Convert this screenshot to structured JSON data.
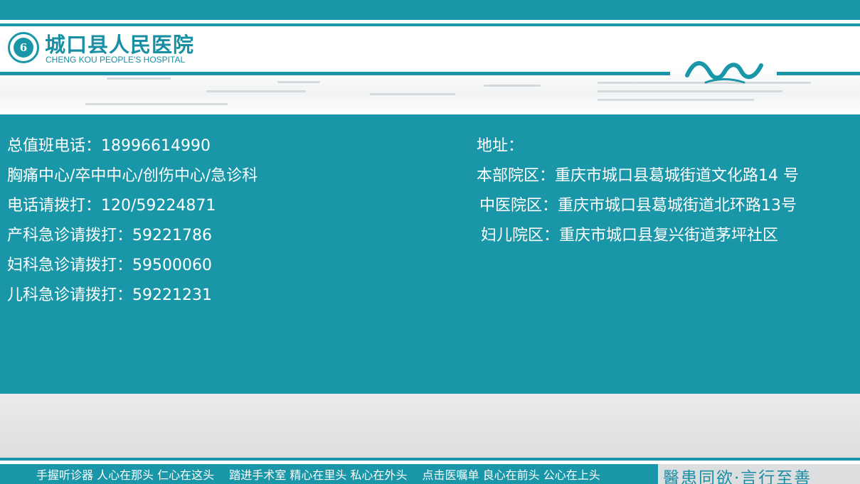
{
  "header": {
    "hospital_name_cn": "城口县人民医院",
    "hospital_name_en": "CHENG KOU PEOPLE'S HOSPITAL",
    "logo_glyph": "6"
  },
  "contacts": [
    "总值班电话：18996614990",
    "胸痛中心/卒中中心/创伤中心/急诊科",
    "电话请拨打：120/59224871",
    "产科急诊请拨打：59221786",
    "妇科急诊请拨打：59500060",
    "儿科急诊请拨打：59221231"
  ],
  "address": {
    "heading": "地址：",
    "lines": [
      "本部院区：重庆市城口县葛城街道文化路14 号",
      "中医院区：重庆市城口县葛城街道北环路13号",
      "妇儿院区：重庆市城口县复兴街道茅坪社区"
    ]
  },
  "footer": {
    "slogan": "手握听诊器 人心在那头 仁心在这头　 踏进手术室 精心在里头 私心在外头　 点击医嘱单 良心在前头 公心在上头",
    "motto": "醫患同欲·言行至善"
  },
  "colors": {
    "brand_teal": "#1a96a9",
    "text_white": "#ffffff",
    "panel_gray": "#dcdedf"
  },
  "icons": {
    "logo": "hospital-logo-icon",
    "waves": "wave-decoration-icon"
  }
}
